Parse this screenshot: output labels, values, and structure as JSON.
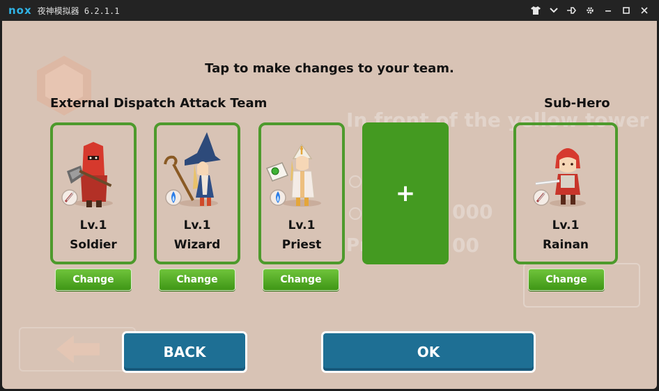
{
  "window": {
    "logo": "nox",
    "title": "夜神模拟器 6.2.1.1",
    "controls": [
      "shirt-icon",
      "chevron-down-icon",
      "pin-icon",
      "gear-icon",
      "minimize-icon",
      "maximize-icon",
      "close-icon"
    ]
  },
  "background": {
    "stage_title": "In front of the yellow tower",
    "value_1": "000",
    "value_2_prefix": "Pr",
    "value_2": "00"
  },
  "instruction": "Tap to make changes to your team.",
  "team": {
    "title": "External Dispatch Attack Team",
    "members": [
      {
        "level": "Lv.1",
        "name": "Soldier",
        "change_label": "Change",
        "weapon": "sword-icon"
      },
      {
        "level": "Lv.1",
        "name": "Wizard",
        "change_label": "Change",
        "weapon": "magic-flame-icon"
      },
      {
        "level": "Lv.1",
        "name": "Priest",
        "change_label": "Change",
        "weapon": "magic-flame-icon"
      }
    ],
    "add_label": "+"
  },
  "sub_hero": {
    "title": "Sub-Hero",
    "level": "Lv.1",
    "name": "Rainan",
    "change_label": "Change",
    "weapon": "sword-icon"
  },
  "actions": {
    "back_label": "BACK",
    "ok_label": "OK"
  },
  "colors": {
    "overlay": "#d8c3b5",
    "card_border": "#4d9a2c",
    "add_slot": "#449a21",
    "action_button": "#1e6f94",
    "logo": "#30b4e6"
  }
}
